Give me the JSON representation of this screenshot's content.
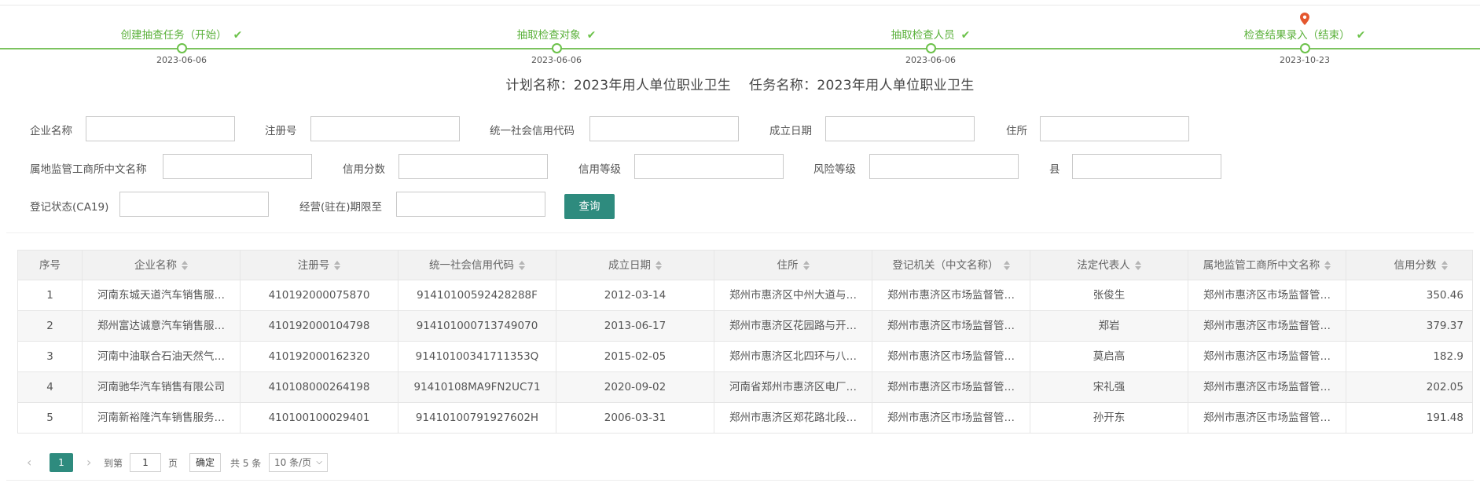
{
  "stepper": {
    "steps": [
      {
        "label": "创建抽查任务（开始）",
        "date": "2023-06-06"
      },
      {
        "label": "抽取检查对象",
        "date": "2023-06-06"
      },
      {
        "label": "抽取检查人员",
        "date": "2023-06-06"
      },
      {
        "label": "检查结果录入（结束）",
        "date": "2023-10-23"
      }
    ],
    "check_glyph": "✔"
  },
  "plan_title": "计划名称：2023年用人单位职业卫生    任务名称：2023年用人单位职业卫生",
  "filters": {
    "company_name": {
      "label": "企业名称",
      "value": ""
    },
    "reg_no": {
      "label": "注册号",
      "value": ""
    },
    "credit_code": {
      "label": "统一社会信用代码",
      "value": ""
    },
    "est_date": {
      "label": "成立日期",
      "value": ""
    },
    "address": {
      "label": "住所",
      "value": ""
    },
    "local_office": {
      "label": "属地监管工商所中文名称",
      "value": ""
    },
    "credit_score": {
      "label": "信用分数",
      "value": ""
    },
    "credit_level": {
      "label": "信用等级",
      "value": ""
    },
    "risk_level": {
      "label": "风险等级",
      "value": ""
    },
    "county": {
      "label": "县",
      "value": ""
    },
    "reg_status": {
      "label": "登记状态(CA19)",
      "value": ""
    },
    "term_end": {
      "label": "经营(驻在)期限至",
      "value": ""
    },
    "query_label": "查询"
  },
  "table": {
    "headers": [
      "序号",
      "企业名称",
      "注册号",
      "统一社会信用代码",
      "成立日期",
      "住所",
      "登记机关（中文名称）",
      "法定代表人",
      "属地监管工商所中文名称",
      "信用分数"
    ],
    "rows": [
      [
        "1",
        "河南东城天道汽车销售服…",
        "410192000075870",
        "91410100592428288F",
        "2012-03-14",
        "郑州市惠济区中州大道与…",
        "郑州市惠济区市场监督管…",
        "张俊生",
        "郑州市惠济区市场监督管…",
        "350.46"
      ],
      [
        "2",
        "郑州富达诚意汽车销售服…",
        "410192000104798",
        "914101000713749070",
        "2013-06-17",
        "郑州市惠济区花园路与开…",
        "郑州市惠济区市场监督管…",
        "郑岩",
        "郑州市惠济区市场监督管…",
        "379.37"
      ],
      [
        "3",
        "河南中油联合石油天然气…",
        "410192000162320",
        "91410100341711353Q",
        "2015-02-05",
        "郑州市惠济区北四环与八…",
        "郑州市惠济区市场监督管…",
        "莫启高",
        "郑州市惠济区市场监督管…",
        "182.9"
      ],
      [
        "4",
        "河南驰华汽车销售有限公司",
        "410108000264198",
        "91410108MA9FN2UC71",
        "2020-09-02",
        "河南省郑州市惠济区电厂…",
        "郑州市惠济区市场监督管…",
        "宋礼强",
        "郑州市惠济区市场监督管…",
        "202.05"
      ],
      [
        "5",
        "河南新裕隆汽车销售服务…",
        "410100100029401",
        "91410100791927602H",
        "2006-03-31",
        "郑州市惠济区郑花路北段…",
        "郑州市惠济区市场监督管…",
        "孙开东",
        "郑州市惠济区市场监督管…",
        "191.48"
      ]
    ]
  },
  "pagination": {
    "current_page": "1",
    "goto_prefix": "到第",
    "goto_value": "1",
    "goto_suffix": "页",
    "confirm_label": "确定",
    "total": "共 5 条",
    "page_size": "10 条/页"
  },
  "colors": {
    "accent": "#2e8b7e",
    "step_green": "#6cc24a",
    "pin": "#e4572e"
  }
}
